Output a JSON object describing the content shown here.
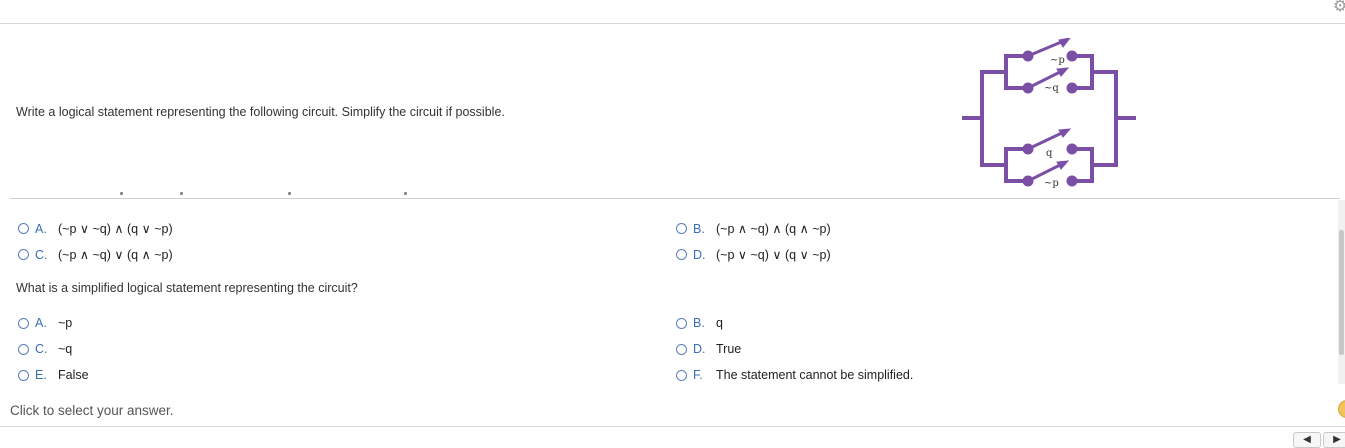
{
  "question": "Write a logical statement representing the following circuit. Simplify the circuit if possible.",
  "circuit": {
    "switch_labels": [
      "~p",
      "~q",
      "q",
      "~p"
    ],
    "color": "#7b4fa6"
  },
  "part1": {
    "options": [
      {
        "letter": "A.",
        "text": "(~p ∨ ~q) ∧ (q ∨ ~p)"
      },
      {
        "letter": "B.",
        "text": "(~p ∧ ~q) ∧ (q ∧ ~p)"
      },
      {
        "letter": "C.",
        "text": "(~p ∧ ~q) ∨ (q ∧ ~p)"
      },
      {
        "letter": "D.",
        "text": "(~p ∨ ~q) ∨ (q ∨ ~p)"
      }
    ]
  },
  "part2": {
    "question": "What is a simplified logical statement representing the circuit?",
    "options": [
      {
        "letter": "A.",
        "text": "~p"
      },
      {
        "letter": "B.",
        "text": "q"
      },
      {
        "letter": "C.",
        "text": "~q"
      },
      {
        "letter": "D.",
        "text": "True"
      },
      {
        "letter": "E.",
        "text": "False"
      },
      {
        "letter": "F.",
        "text": "The statement cannot be simplified."
      }
    ]
  },
  "hint": "Click to select your answer.",
  "nav": {
    "prev": "◀",
    "next": "▶"
  }
}
